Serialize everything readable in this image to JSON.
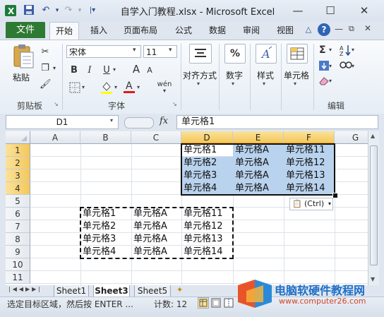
{
  "titlebar": {
    "title": "自学入门教程.xlsx - Microsoft Excel",
    "minimize": "—",
    "maximize": "☐",
    "close": "✕"
  },
  "tabs": {
    "file": "文件",
    "items": [
      "开始",
      "插入",
      "页面布局",
      "公式",
      "数据",
      "审阅",
      "视图"
    ]
  },
  "ribbon": {
    "paste": "粘贴",
    "clipboard": "剪贴板",
    "font_name": "宋体",
    "font_size": "11",
    "font_group": "字体",
    "bold": "B",
    "italic": "I",
    "underline": "U",
    "grow": "A",
    "shrink": "A",
    "phonetic": "wén",
    "align": "对齐方式",
    "number": "数字",
    "number_symbol": "%",
    "style": "样式",
    "cells": "单元格",
    "editing": "编辑",
    "sigma": "Σ"
  },
  "formula_bar": {
    "name_box": "D1",
    "fx": "fx",
    "content": "单元格1"
  },
  "grid": {
    "columns": [
      "A",
      "B",
      "C",
      "D",
      "E",
      "F",
      "G"
    ],
    "rows": [
      "1",
      "2",
      "3",
      "4",
      "5",
      "6",
      "7",
      "8",
      "9",
      "10",
      "11"
    ],
    "selected_block": [
      [
        "单元格1",
        "单元格A",
        "单元格11"
      ],
      [
        "单元格2",
        "单元格A",
        "单元格12"
      ],
      [
        "单元格3",
        "单元格A",
        "单元格13"
      ],
      [
        "单元格4",
        "单元格A",
        "单元格14"
      ]
    ],
    "copied_block": [
      [
        "单元格1",
        "单元格A",
        "单元格11"
      ],
      [
        "单元格2",
        "单元格A",
        "单元格12"
      ],
      [
        "单元格3",
        "单元格A",
        "单元格13"
      ],
      [
        "单元格4",
        "单元格A",
        "单元格14"
      ]
    ],
    "paste_options": "(Ctrl)"
  },
  "sheets": [
    "Sheet1",
    "Sheet3",
    "Sheet5"
  ],
  "status": {
    "message": "选定目标区域，然后按 ENTER ...",
    "count": "计数: 12"
  },
  "watermark": {
    "line1": "电脑软硬件教程网",
    "line2": "www.computer26.com"
  },
  "colors": {
    "file_tab": "#2f7a33",
    "selection": "#b9d3ee",
    "header_highlight": "#f4c85a"
  }
}
